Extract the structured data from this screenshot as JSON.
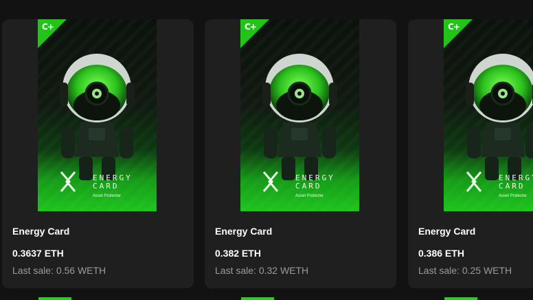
{
  "cards": [
    {
      "name": "Energy Card",
      "price": "0.3637 ETH",
      "last_sale": "Last sale: 0.56 WETH",
      "art": {
        "logo": "C+",
        "brand_line1": "ENERGY",
        "brand_line2": "CARD",
        "brand_sub": "Asset Protecter"
      }
    },
    {
      "name": "Energy Card",
      "price": "0.382 ETH",
      "last_sale": "Last sale: 0.32 WETH",
      "art": {
        "logo": "C+",
        "brand_line1": "ENERGY",
        "brand_line2": "CARD",
        "brand_sub": "Asset Protecter"
      }
    },
    {
      "name": "Energy Card",
      "price": "0.386 ETH",
      "last_sale": "Last sale: 0.25 WETH",
      "art": {
        "logo": "C+",
        "brand_line1": "ENERGY",
        "brand_line2": "CARD",
        "brand_sub": "Asset Protecter"
      }
    }
  ],
  "colors": {
    "background": "#121212",
    "card": "#1f1f1f",
    "accent_green": "#22c41a",
    "muted_text": "#9b9b9b"
  }
}
